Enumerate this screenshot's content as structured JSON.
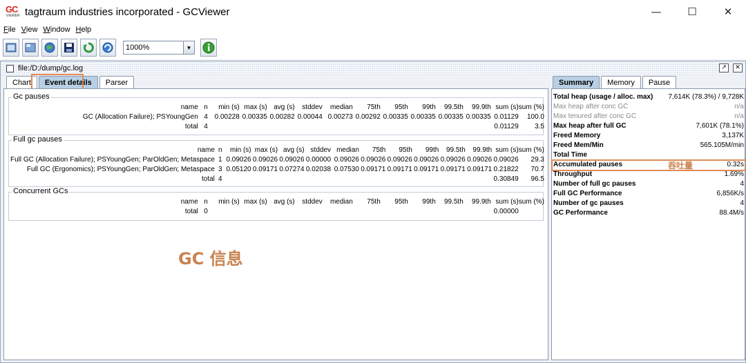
{
  "window": {
    "title": "tagtraum industries incorporated - GCViewer",
    "logo_text": "GC",
    "logo_subtext": "VIEWER",
    "minimize": "—",
    "maximize": "☐",
    "close": "✕"
  },
  "menu": [
    "File",
    "View",
    "Window",
    "Help"
  ],
  "toolbar": {
    "zoom_value": "1000%",
    "buttons": [
      "open-file-icon",
      "open-url-icon",
      "refresh-icon",
      "save-icon",
      "watch-icon",
      "export-icon"
    ],
    "info_icon": "info-icon"
  },
  "frame": {
    "title": "file:/D:/dump/gc.log"
  },
  "left_tabs": [
    "Chart",
    "Event details",
    "Parser"
  ],
  "right_tabs": [
    "Summary",
    "Memory",
    "Pause"
  ],
  "columns": [
    "name",
    "n",
    "min (s)",
    "max (s)",
    "avg (s)",
    "stddev",
    "median",
    "75th",
    "95th",
    "99th",
    "99.5th",
    "99.9th",
    "sum (s)",
    "sum (%)"
  ],
  "gc_pauses": {
    "title": "Gc pauses",
    "rows": [
      [
        "GC (Allocation Failure); PSYoungGen",
        "4",
        "0.00228",
        "0.00335",
        "0.00282",
        "0.00044",
        "0.00273",
        "0.00292",
        "0.00335",
        "0.00335",
        "0.00335",
        "0.00335",
        "0.01129",
        "100.0"
      ],
      [
        "total",
        "4",
        "",
        "",
        "",
        "",
        "",
        "",
        "",
        "",
        "",
        "",
        "0.01129",
        "3.5"
      ]
    ]
  },
  "full_gc_pauses": {
    "title": "Full gc pauses",
    "rows": [
      [
        "Full GC (Allocation Failure); PSYoungGen; ParOldGen; Metaspace",
        "1",
        "0.09026",
        "0.09026",
        "0.09026",
        "0.00000",
        "0.09026",
        "0.09026",
        "0.09026",
        "0.09026",
        "0.09026",
        "0.09026",
        "0.09026",
        "29.3"
      ],
      [
        "Full GC (Ergonomics); PSYoungGen; ParOldGen; Metaspace",
        "3",
        "0.05120",
        "0.09171",
        "0.07274",
        "0.02038",
        "0.07530",
        "0.09171",
        "0.09171",
        "0.09171",
        "0.09171",
        "0.09171",
        "0.21822",
        "70.7"
      ],
      [
        "total",
        "4",
        "",
        "",
        "",
        "",
        "",
        "",
        "",
        "",
        "",
        "",
        "0.30849",
        "96.5"
      ]
    ]
  },
  "concurrent_gcs": {
    "title": "Concurrent GCs",
    "rows": [
      [
        "total",
        "0",
        "",
        "",
        "",
        "",
        "",
        "",
        "",
        "",
        "",
        "",
        "0.00000",
        ""
      ]
    ]
  },
  "annotation_gc_info": "GC 信息",
  "annotation_throughput": "吞吐量",
  "summary": [
    {
      "k": "Total heap (usage / alloc. max)",
      "v": "7,614K (78.3%) / 9,728K",
      "dim": false
    },
    {
      "k": "Max heap after conc GC",
      "v": "n/a",
      "dim": true
    },
    {
      "k": "Max tenured after conc GC",
      "v": "n/a",
      "dim": true
    },
    {
      "k": "Max heap after full GC",
      "v": "7,601K (78.1%)",
      "dim": false
    },
    {
      "k": "Freed Memory",
      "v": "3,137K",
      "dim": false
    },
    {
      "k": "Freed Mem/Min",
      "v": "565.105M/min",
      "dim": false
    },
    {
      "k": "Total Time",
      "v": "",
      "dim": false
    },
    {
      "k": "Accumulated pauses",
      "v": "0.32s",
      "dim": false
    },
    {
      "k": "Throughput",
      "v": "1.69%",
      "dim": false
    },
    {
      "k": "Number of full gc pauses",
      "v": "4",
      "dim": false
    },
    {
      "k": "Full GC Performance",
      "v": "6,856K/s",
      "dim": false
    },
    {
      "k": "Number of gc pauses",
      "v": "4",
      "dim": false
    },
    {
      "k": "GC Performance",
      "v": "88.4M/s",
      "dim": false
    }
  ],
  "colors": {
    "annotation": "#c9824f",
    "annotation_border": "#e08a55",
    "active_tab": "#b8cfe5"
  }
}
